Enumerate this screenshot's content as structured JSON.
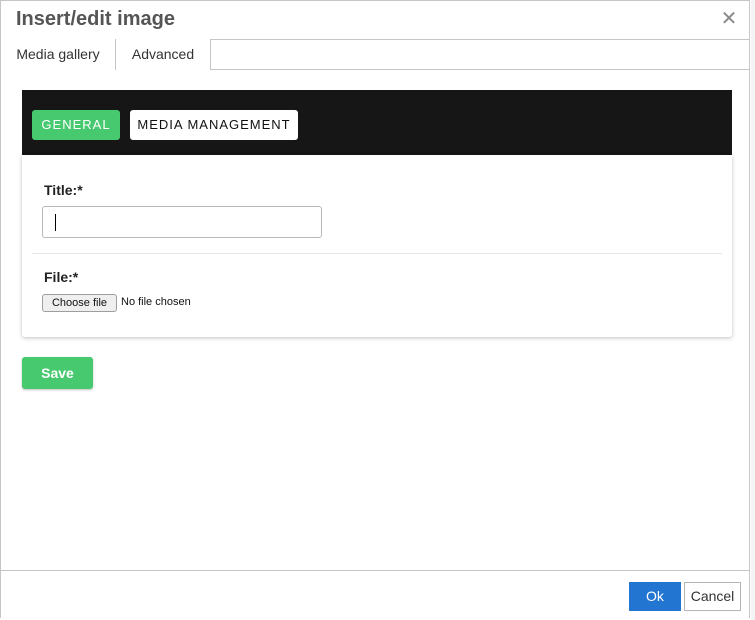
{
  "dialog": {
    "title": "Insert/edit image",
    "close_icon": "close-icon"
  },
  "tabs": [
    {
      "label": "Media gallery",
      "active": true
    },
    {
      "label": "Advanced",
      "active": false
    }
  ],
  "media_nav": {
    "general_label": "GENERAL",
    "media_management_label": "MEDIA MANAGEMENT"
  },
  "form": {
    "title_label": "Title:*",
    "title_value": "",
    "file_label": "File:*",
    "choose_file_label": "Choose file",
    "no_file_text": "No file chosen"
  },
  "save_label": "Save",
  "footer": {
    "ok_label": "Ok",
    "cancel_label": "Cancel"
  },
  "colors": {
    "accent_green": "#47c96f",
    "primary_blue": "#2276d2",
    "topbar_dark": "#161616"
  }
}
